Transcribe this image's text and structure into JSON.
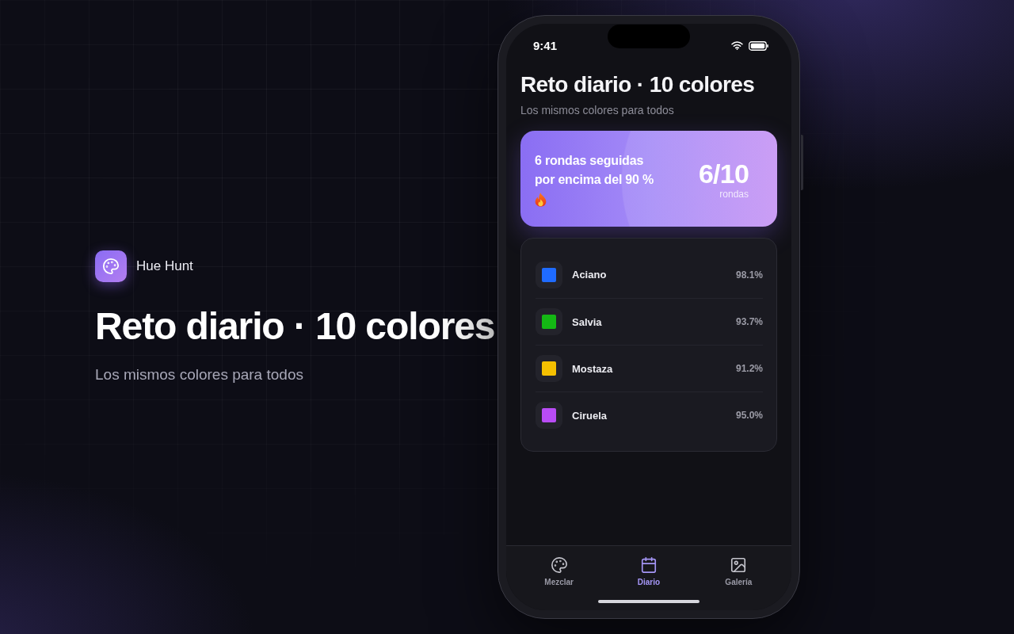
{
  "brand": {
    "name": "Hue Hunt"
  },
  "hero": {
    "title": "Reto diario · 10 colores",
    "subtitle": "Los mismos colores para todos"
  },
  "phone": {
    "status_bar": {
      "time": "9:41"
    },
    "header": {
      "title": "Reto diario · 10 colores",
      "subtitle": "Los mismos colores para todos"
    },
    "streak_card": {
      "message": "6 rondas seguidas por encima del 90 %",
      "score": "6/10",
      "score_label": "rondas"
    },
    "colors": [
      {
        "name": "Aciano",
        "color": "#1f6bff",
        "score": "98.1%"
      },
      {
        "name": "Salvia",
        "color": "#14b814",
        "score": "93.7%"
      },
      {
        "name": "Mostaza",
        "color": "#f5c000",
        "score": "91.2%"
      },
      {
        "name": "Ciruela",
        "color": "#b84cf5",
        "score": "95.0%"
      }
    ],
    "tab_bar": [
      {
        "label": "Mezclar",
        "selected": false
      },
      {
        "label": "Diario",
        "selected": true
      },
      {
        "label": "Galería",
        "selected": false
      }
    ]
  }
}
